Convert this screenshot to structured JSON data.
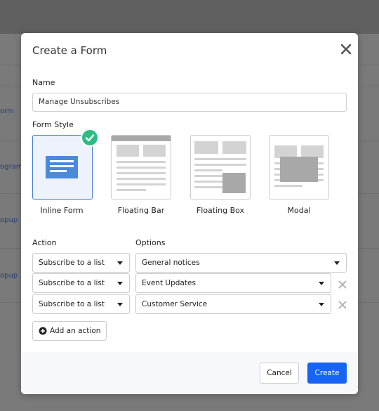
{
  "background": {
    "links": [
      "orm",
      "ogram",
      "opup",
      "opup"
    ]
  },
  "modal": {
    "title": "Create a Form",
    "close_icon": "close-icon"
  },
  "name_field": {
    "label": "Name",
    "value": "Manage Unsubscribes"
  },
  "form_style": {
    "label": "Form Style",
    "selected": "Inline Form",
    "options": [
      {
        "name": "Inline Form",
        "icon": "inline-form-icon"
      },
      {
        "name": "Floating Bar",
        "icon": "floating-bar-icon"
      },
      {
        "name": "Floating Box",
        "icon": "floating-box-icon"
      },
      {
        "name": "Modal",
        "icon": "modal-icon"
      }
    ],
    "check_icon": "checkmark-icon"
  },
  "actions": {
    "action_label": "Action",
    "options_label": "Options",
    "rows": [
      {
        "action": "Subscribe to a list",
        "option": "General notices",
        "removable": false
      },
      {
        "action": "Subscribe to a list",
        "option": "Event Updates",
        "removable": true
      },
      {
        "action": "Subscribe to a list",
        "option": "Customer Service",
        "removable": true
      }
    ],
    "add_label": "Add an action"
  },
  "footer": {
    "cancel_label": "Cancel",
    "create_label": "Create"
  },
  "colors": {
    "primary": "#1663f5",
    "selected_border": "#3e7bd4",
    "check_green": "#2dbd83",
    "footer_bg": "#f6f8fc"
  }
}
